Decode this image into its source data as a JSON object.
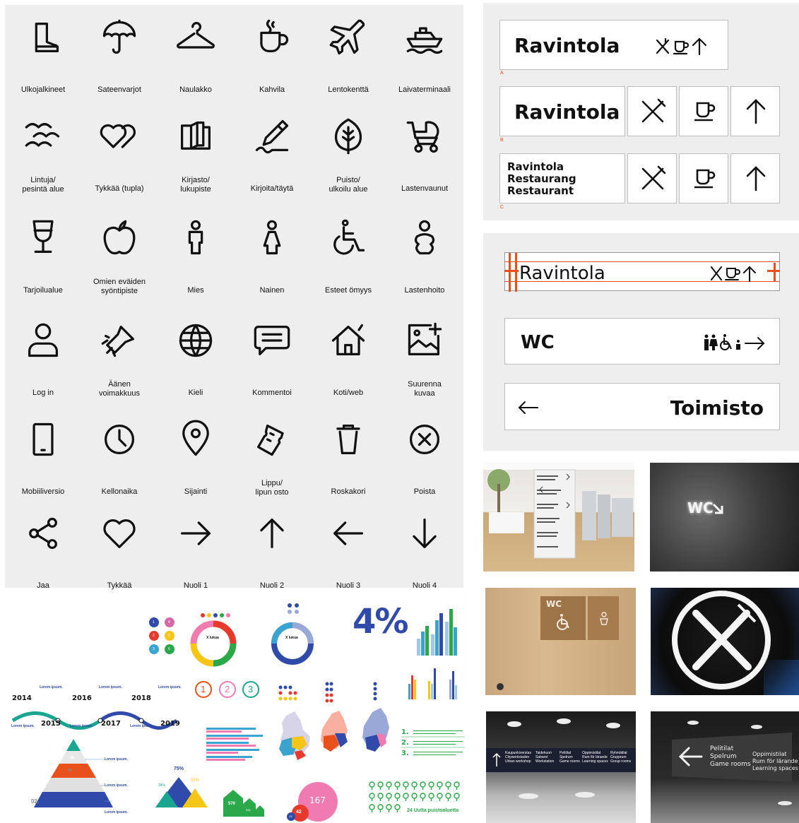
{
  "icons": [
    {
      "icon": "boot-icon",
      "label": "Ulkojalkineet"
    },
    {
      "icon": "umbrella-icon",
      "label": "Sateenvarjot"
    },
    {
      "icon": "hanger-icon",
      "label": "Naulakko"
    },
    {
      "icon": "coffee-cup-icon",
      "label": "Kahvila"
    },
    {
      "icon": "airplane-icon",
      "label": "Lentokenttä"
    },
    {
      "icon": "ship-icon",
      "label": "Laivaterminaali"
    },
    {
      "icon": "birds-icon",
      "label": "Lintuja/\npesintä alue"
    },
    {
      "icon": "double-heart-icon",
      "label": "Tykkää (tupla)"
    },
    {
      "icon": "book-icon",
      "label": "Kirjasto/\nlukupiste"
    },
    {
      "icon": "pencil-icon",
      "label": "Kirjoita/täytä"
    },
    {
      "icon": "leaf-icon",
      "label": "Puisto/\nulkoilu alue"
    },
    {
      "icon": "stroller-icon",
      "label": "Lastenvaunut"
    },
    {
      "icon": "wine-glass-icon",
      "label": "Tarjoilualue"
    },
    {
      "icon": "apple-icon",
      "label": "Omien eväiden\nsyöntipiste"
    },
    {
      "icon": "man-icon",
      "label": "Mies"
    },
    {
      "icon": "woman-icon",
      "label": "Nainen"
    },
    {
      "icon": "wheelchair-icon",
      "label": "Esteet ömyys"
    },
    {
      "icon": "baby-icon",
      "label": "Lastenhoito"
    },
    {
      "icon": "user-icon",
      "label": "Log in"
    },
    {
      "icon": "megaphone-icon",
      "label": "Äänen\nvoimakkuus"
    },
    {
      "icon": "globe-icon",
      "label": "Kieli"
    },
    {
      "icon": "comment-icon",
      "label": "Kommentoi"
    },
    {
      "icon": "home-icon",
      "label": "Koti/web"
    },
    {
      "icon": "image-plus-icon",
      "label": "Suurenna\nkuvaa"
    },
    {
      "icon": "mobile-icon",
      "label": "Mobiiliversio"
    },
    {
      "icon": "clock-icon",
      "label": "Kellonaika"
    },
    {
      "icon": "location-pin-icon",
      "label": "Sijainti"
    },
    {
      "icon": "ticket-icon",
      "label": "Lippu/\nlipun osto"
    },
    {
      "icon": "trash-icon",
      "label": "Roskakori"
    },
    {
      "icon": "close-circle-icon",
      "label": "Poista"
    },
    {
      "icon": "share-icon",
      "label": "Jaa"
    },
    {
      "icon": "heart-icon",
      "label": "Tykkää"
    },
    {
      "icon": "arrow-right-icon",
      "label": "Nuoli 1"
    },
    {
      "icon": "arrow-up-icon",
      "label": "Nuoli 2"
    },
    {
      "icon": "arrow-left-icon",
      "label": "Nuoli 3"
    },
    {
      "icon": "arrow-down-icon",
      "label": "Nuoli 4"
    }
  ],
  "signs_top": {
    "a": {
      "text": "Ravintola",
      "letter": "A"
    },
    "b": {
      "text": "Ravintola",
      "letter": "B"
    },
    "c": {
      "line1": "Ravintola",
      "line2": "Restaurang",
      "line3": "Restaurant",
      "letter": "C"
    }
  },
  "signs_mid": {
    "grid_sign": "Ravintola",
    "wc_sign": "WC",
    "office_sign": "Toimisto"
  },
  "photos": {
    "wc_wall_text": "WC",
    "wood_sign_text": "WC",
    "hall_sign_left": "Kaupunkiverstas\nCitywerkstaden\nUrban workshop",
    "hall_sign_mid": "Taidekuori\nSabaret\nWorkstation",
    "hall_sign_right1": "Pelitilat\nSpelrum\nGame rooms",
    "hall_sign_right2": "Oppimistilat\nRum för lärande\nLearning spaces",
    "hall_sign_right3": "Ryhmätilat\nGrupprum\nGroup rooms",
    "corridor_sign_left": "Pelitilat\nSpelrum\nGame rooms",
    "corridor_sign_right": "Oppimistilat\nRum för lärande\nLearning spaces"
  },
  "infographics": {
    "numbers": [
      "1",
      "2",
      "3",
      "4",
      "5",
      "6"
    ],
    "circled": [
      "1",
      "2",
      "3"
    ],
    "percent": "4%",
    "donut_label": "X lukua",
    "years_top": [
      "2014",
      "2016",
      "2018"
    ],
    "years_bottom": [
      "2015",
      "2017",
      "2019"
    ],
    "lorem": "Lorem ipsum.",
    "pyramid": [
      "05.",
      "04.",
      "03.",
      "02.",
      "01."
    ],
    "mountain_values": [
      "75%",
      "34%",
      "55%"
    ],
    "house_values": [
      "570",
      "330"
    ],
    "bubble_values": [
      "167",
      "42",
      "13"
    ],
    "list_numbers": [
      "1.",
      "2.",
      "3."
    ],
    "trees_caption": "24 Uutta puistoaluetta"
  },
  "colors": {
    "panel_bg": "#eeeeee",
    "accent_orange": "#e8501c",
    "blue": "#2f4aa8",
    "teal": "#1aa58f",
    "pink": "#ef7bb0",
    "red": "#e63a2e",
    "yellow": "#f5c518",
    "green": "#2aa84a"
  }
}
